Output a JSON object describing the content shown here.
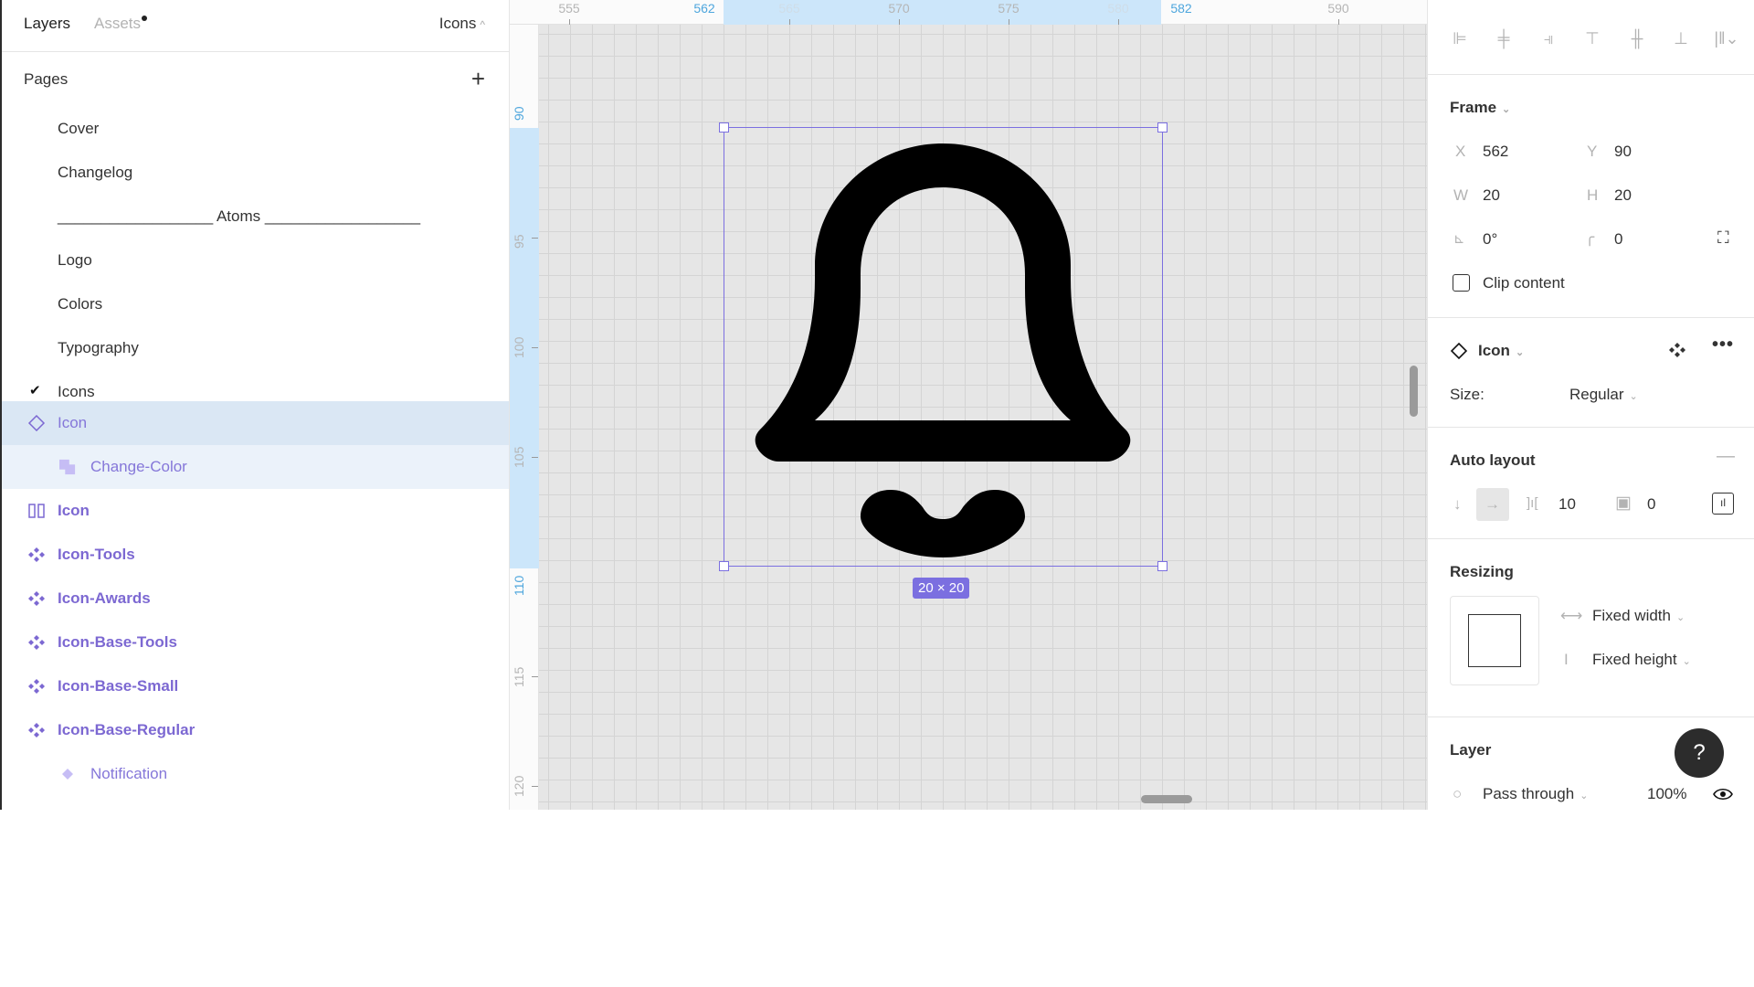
{
  "left_panel": {
    "tabs": {
      "layers": "Layers",
      "assets": "Assets"
    },
    "current_page": "Icons",
    "pages_title": "Pages",
    "pages": [
      {
        "label": "Cover"
      },
      {
        "label": "Changelog"
      },
      {
        "label": "__________________ Atoms __________________"
      },
      {
        "label": "Logo"
      },
      {
        "label": "Colors"
      },
      {
        "label": "Typography"
      },
      {
        "label": "Icons",
        "checked": true
      }
    ],
    "layers": [
      {
        "label": "Icon",
        "icon": "component-variant-diamond-icon",
        "state": "selected"
      },
      {
        "label": "Change-Color",
        "icon": "instance-stack-icon",
        "state": "child-of-selected"
      },
      {
        "label": "Icon",
        "icon": "frame-columns-icon",
        "state": "normal"
      },
      {
        "label": "Icon-Tools",
        "icon": "component-set-icon",
        "state": "normal"
      },
      {
        "label": "Icon-Awards",
        "icon": "component-set-icon",
        "state": "normal"
      },
      {
        "label": "Icon-Base-Tools",
        "icon": "component-set-icon",
        "state": "normal"
      },
      {
        "label": "Icon-Base-Small",
        "icon": "component-set-icon",
        "state": "normal"
      },
      {
        "label": "Icon-Base-Regular",
        "icon": "component-set-icon",
        "state": "normal"
      },
      {
        "label": "Notification",
        "icon": "component-diamond-icon",
        "state": "child"
      }
    ]
  },
  "canvas": {
    "ruler_top": [
      "555",
      "562",
      "565",
      "570",
      "575",
      "580",
      "582",
      "590"
    ],
    "ruler_left": [
      "90",
      "95",
      "100",
      "105",
      "110",
      "115",
      "120"
    ],
    "selection_size": "20 × 20",
    "selected_icon": "bell-icon"
  },
  "right_panel": {
    "frame": {
      "title": "Frame",
      "x_label": "X",
      "x": "562",
      "y_label": "Y",
      "y": "90",
      "w_label": "W",
      "w": "20",
      "h_label": "H",
      "h": "20",
      "rotation": "0°",
      "radius": "0",
      "clip_content": "Clip content",
      "clip_checked": false
    },
    "component": {
      "name": "Icon",
      "size_label": "Size:",
      "size_value": "Regular"
    },
    "auto_layout": {
      "title": "Auto layout",
      "direction": "horizontal",
      "spacing": "10",
      "padding": "0"
    },
    "resizing": {
      "title": "Resizing",
      "width_mode": "Fixed width",
      "height_mode": "Fixed height"
    },
    "layer": {
      "title": "Layer",
      "blend_mode": "Pass through",
      "opacity": "100%"
    },
    "help": "?"
  },
  "colors": {
    "selection": "#7b6fe0",
    "ruler_highlight": "#cce6fa",
    "layer_selected_bg": "#dae7f4",
    "component_purple": "#7c68d2"
  }
}
